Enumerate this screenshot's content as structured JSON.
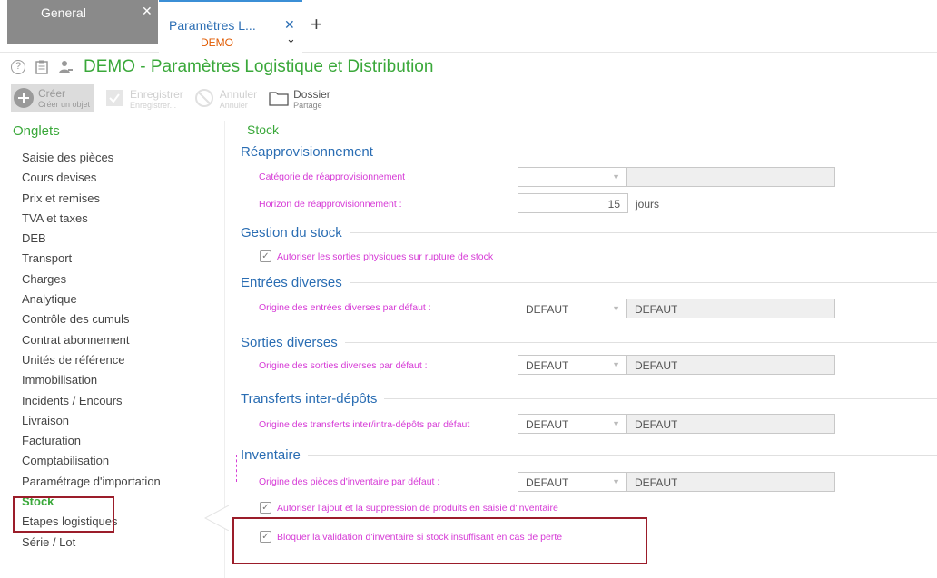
{
  "tabs": {
    "general": {
      "label": "General",
      "close": "✕"
    },
    "active": {
      "label": "Paramètres L...",
      "sub": "DEMO",
      "close": "✕",
      "chev": "⌄"
    },
    "add": "+"
  },
  "header": {
    "icons": [
      "help-icon",
      "clipboard-icon",
      "user-icon"
    ],
    "title": "DEMO - Paramètres Logistique et Distribution"
  },
  "toolbar": {
    "create": {
      "label": "Créer",
      "sub": "Créer un objet"
    },
    "save": {
      "label": "Enregistrer",
      "sub": "Enregistrer..."
    },
    "cancel": {
      "label": "Annuler",
      "sub": "Annuler"
    },
    "folder": {
      "label": "Dossier",
      "sub": "Partage"
    }
  },
  "sidebar": {
    "header": "Onglets",
    "items": [
      "Saisie des pièces",
      "Cours devises",
      "Prix et remises",
      "TVA et taxes",
      "DEB",
      "Transport",
      "Charges",
      "Analytique",
      "Contrôle des cumuls",
      "Contrat abonnement",
      "Unités de référence",
      "Immobilisation",
      "Incidents / Encours",
      "Livraison",
      "Facturation",
      "Comptabilisation",
      "Paramétrage d'importation",
      "Stock",
      "Etapes logistiques",
      "Série / Lot"
    ],
    "active_index": 17
  },
  "main": {
    "title": "Stock",
    "reappro": {
      "title": "Réapprovisionnement",
      "cat_label": "Catégorie de réapprovisionnement :",
      "cat_value": "",
      "cat_desc": "",
      "horizon_label": "Horizon de réapprovisionnement :",
      "horizon_value": "15",
      "horizon_unit": "jours"
    },
    "gestion": {
      "title": "Gestion du stock",
      "chk_label": "Autoriser les sorties physiques sur rupture de stock",
      "checked": true
    },
    "entrees": {
      "title": "Entrées diverses",
      "label": "Origine des entrées diverses par défaut :",
      "value": "DEFAUT",
      "desc": "DEFAUT"
    },
    "sorties": {
      "title": "Sorties diverses",
      "label": "Origine des sorties diverses par défaut :",
      "value": "DEFAUT",
      "desc": "DEFAUT"
    },
    "transferts": {
      "title": "Transferts inter-dépôts",
      "label": "Origine des transferts inter/intra-dépôts par défaut",
      "value": "DEFAUT",
      "desc": "DEFAUT"
    },
    "inventaire": {
      "title": "Inventaire",
      "label": "Origine des pièces d'inventaire par défaut :",
      "value": "DEFAUT",
      "desc": "DEFAUT",
      "chk1": "Autoriser l'ajout et la suppression de produits en saisie d'inventaire",
      "chk2": "Bloquer la validation d'inventaire si stock insuffisant en cas de perte",
      "chk1_checked": true,
      "chk2_checked": true
    }
  },
  "colors": {
    "green": "#3aa83a",
    "blue": "#2a6db3",
    "magenta": "#d63ad6",
    "highlight": "#9b1d2a",
    "tab_gray": "#8a8a8a"
  }
}
